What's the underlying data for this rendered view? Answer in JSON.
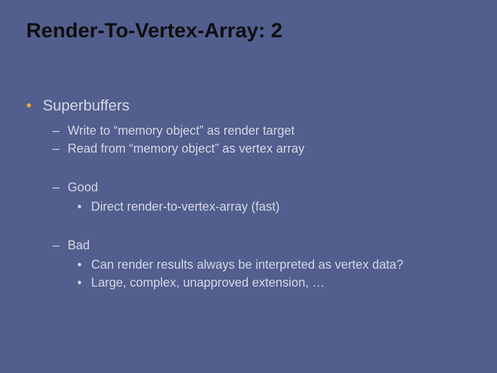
{
  "title": "Render-To-Vertex-Array: 2",
  "b1": "•",
  "b2": "–",
  "b3": "•",
  "heading": "Superbuffers",
  "sub1": "Write to “memory object” as render target",
  "sub2": "Read from “memory object” as vertex array",
  "good_label": "Good",
  "good_1": "Direct render-to-vertex-array (fast)",
  "bad_label": "Bad",
  "bad_1": "Can render results always be interpreted as vertex data?",
  "bad_2": "Large, complex, unapproved extension, …"
}
